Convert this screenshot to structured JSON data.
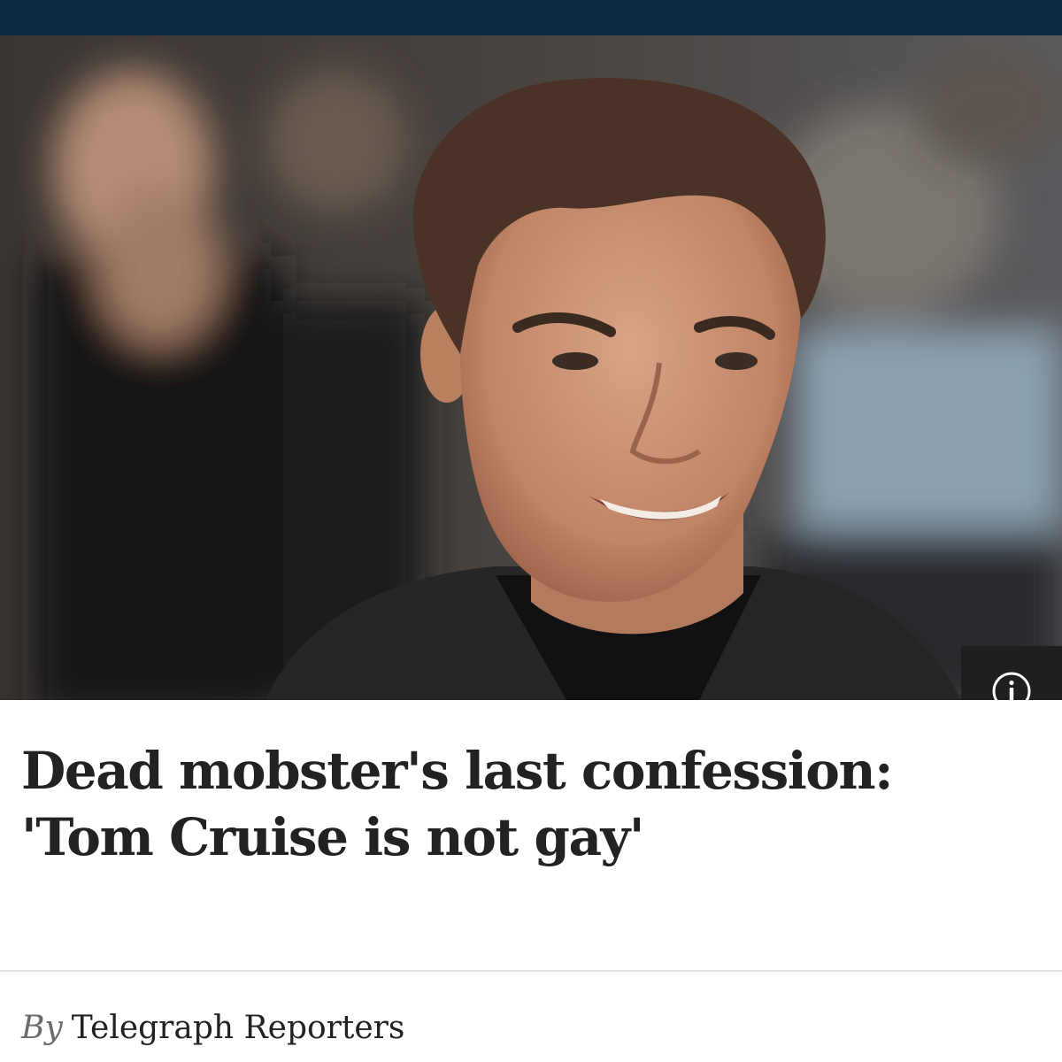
{
  "article": {
    "headline": "Dead mobster's last confession: 'Tom Cruise is not gay'",
    "byline_prefix": "By",
    "author": "Telegraph Reporters"
  },
  "hero_image": {
    "info_icon": "info-icon"
  },
  "colors": {
    "topbar": "#0b2b3e",
    "headline_text": "#222222",
    "byline_prefix": "#6a6a6a",
    "info_box": "#1f1f1f"
  }
}
